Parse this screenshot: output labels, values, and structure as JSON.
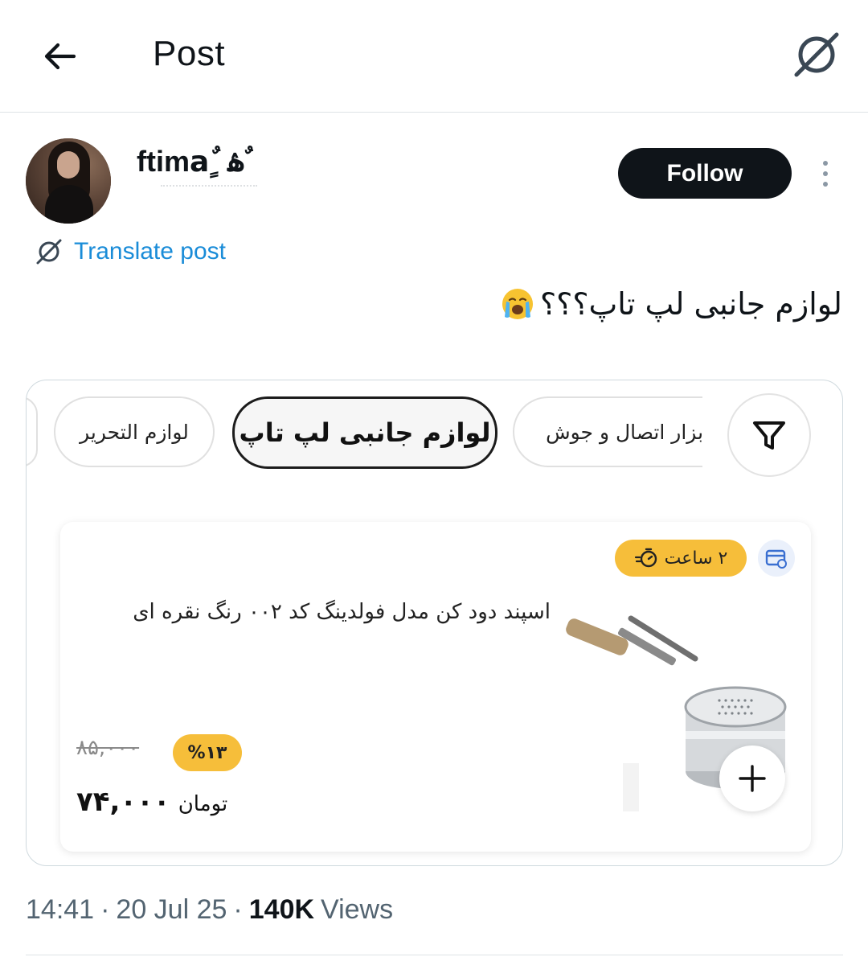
{
  "header": {
    "title": "Post",
    "back_icon": "arrow-left-icon",
    "translate_icon": "translate-icon"
  },
  "author": {
    "name": "ftimaٌ ٍ ۿ ٌ",
    "follow_label": "Follow",
    "avatar": "avatar-photo"
  },
  "translate_label": "Translate post",
  "post": {
    "text": "لوازم جانبی لپ تاپ؟؟؟",
    "emoji": "loudly-crying-face"
  },
  "media": {
    "chips": [
      {
        "label": "لوازم التحریر",
        "active": false
      },
      {
        "label": "لوازم جانبی لپ تاپ",
        "active": true
      },
      {
        "label": "ابزار اتصال و جوش",
        "active": false
      }
    ],
    "filter_icon": "filter-icon",
    "product": {
      "timer": "۲ ساعت",
      "title": "اسپند دود کن مدل فولدینگ کد ۰۰۲ رنگ نقره ای",
      "old_price": "۸۵,۰۰۰",
      "discount": "%۱۳",
      "price": "۷۴,۰۰۰",
      "currency": "تومان"
    }
  },
  "meta": {
    "time": "14:41",
    "date": "20 Jul 25",
    "views_count": "140K",
    "views_label": "Views",
    "separator": "·"
  },
  "colors": {
    "link": "#1a8cd8",
    "follow_bg": "#0f1419",
    "badge_yellow": "#f6be3a",
    "muted_text": "#536471"
  }
}
